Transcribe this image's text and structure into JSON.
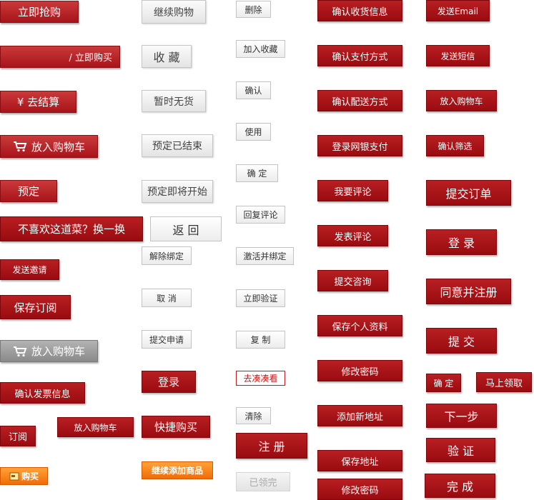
{
  "colors": {
    "primary_red": "#b2181e",
    "dark_red": "#9c0c12",
    "gray": "#e8e8e8",
    "orange": "#f47a10"
  },
  "col1": {
    "buy_now": "立即抢购",
    "buy_now2": "/ 立即购买",
    "checkout": "¥ 去结算",
    "add_cart": "放入购物车",
    "reserve": "预定",
    "swap_dish": "不喜欢这道菜？换一换",
    "send_invite": "发送邀请",
    "save_order": "保存订阅",
    "add_cart_disabled": "放入购物车",
    "confirm_invoice": "确认发票信息",
    "subscribe": "订阅",
    "buy": "购买"
  },
  "col2": {
    "continue_shopping": "继续购物",
    "favorite": "收 藏",
    "out_of_stock": "暂时无货",
    "reservation_ended": "预定已结束",
    "reservation_soon": "预定即将开始",
    "back": "返 回",
    "unbind": "解除绑定",
    "cancel": "取 消",
    "submit_application": "提交申请",
    "login": "登录",
    "quick_buy": "快捷购买",
    "add_cart_small": "放入购物车",
    "continue_add": "继续添加商品"
  },
  "col3": {
    "delete": "删除",
    "add_favorite": "加入收藏",
    "confirm": "确认",
    "use": "使用",
    "ok": "确 定",
    "reply_review": "回复评论",
    "activate_bind": "激活并绑定",
    "verify_now": "立即验证",
    "copy": "复 制",
    "pool_together": "去凑凑看",
    "clear": "清除",
    "register": "注 册",
    "claimed": "已领完"
  },
  "col4": {
    "confirm_delivery_info": "确认收货信息",
    "confirm_payment": "确认支付方式",
    "confirm_shipping": "确认配送方式",
    "login_bank_pay": "登录网银支付",
    "write_review": "我要评论",
    "post_review": "发表评论",
    "submit_inquiry": "提交咨询",
    "save_profile": "保存个人资料",
    "change_password": "修改密码",
    "add_address": "添加新地址",
    "save_address": "保存地址",
    "change_password2": "修改密码"
  },
  "col5": {
    "send_email": "发送Email",
    "send_sms": "发送短信",
    "add_to_cart": "放入购物车",
    "confirm_filter": "确认筛选",
    "submit_order": "提交订单",
    "login": "登 录",
    "agree_register": "同意并注册",
    "submit": "提 交",
    "ok": "确 定",
    "claim_now": "马上领取",
    "next_step": "下一步",
    "verify": "验 证",
    "done": "完 成"
  }
}
